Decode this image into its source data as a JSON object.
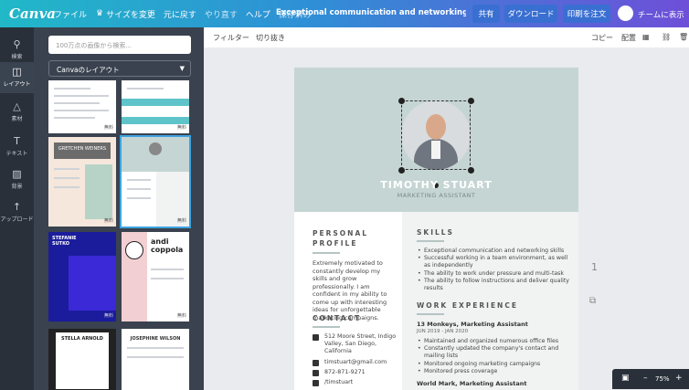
{
  "topbar": {
    "logo": "Canva",
    "menu": [
      "ファイル",
      "サイズを変更",
      "元に戻す",
      "やり直す",
      "ヘルプ",
      "保存済み"
    ],
    "doc_title": "Exceptional communication and networking skillsSucce...",
    "share": "共有",
    "download": "ダウンロード",
    "print": "印刷を注文",
    "team": "チームに表示"
  },
  "rail": {
    "items": [
      {
        "label": "検索",
        "icon": "search-icon"
      },
      {
        "label": "レイアウト",
        "icon": "layout-icon"
      },
      {
        "label": "素材",
        "icon": "elements-icon"
      },
      {
        "label": "テキスト",
        "icon": "text-icon"
      },
      {
        "label": "背景",
        "icon": "background-icon"
      },
      {
        "label": "アップロード",
        "icon": "upload-icon"
      }
    ]
  },
  "panel": {
    "search_placeholder": "100万点の画像から検索...",
    "select_value": "Canvaのレイアウト",
    "free_label": "無料",
    "thumbs": [
      {
        "name": "",
        "color": "#ffffff",
        "accent": "#e5e7ea"
      },
      {
        "name": "",
        "color": "#ffffff",
        "accent": "#5fc4c9"
      },
      {
        "name": "GRETCHEN WEINERS",
        "color": "#f5e7dc",
        "accent": "#6b6b6b"
      },
      {
        "name": "",
        "color": "#ffffff",
        "accent": "#c5d5d3"
      },
      {
        "name": "STEFANIE SUTKO",
        "color": "#1b1c9c",
        "accent": "#3b28d6"
      },
      {
        "name": "andi coppola",
        "color": "#ffffff",
        "accent": "#f2cfd3"
      },
      {
        "name": "STELLA ARNOLD",
        "color": "#ffffff",
        "accent": "#222222"
      },
      {
        "name": "JOSEPHINE WILSON",
        "color": "#ffffff",
        "accent": "#333333"
      }
    ]
  },
  "subbar": {
    "filter": "フィルター",
    "crop": "切り抜き",
    "copy": "コピー",
    "arrange": "配置"
  },
  "resume": {
    "name": "TIMOTHY STUART",
    "role": "MARKETING ASSISTANT",
    "profile_heading": "PERSONAL PROFILE",
    "profile_text": "Extremely motivated to constantly develop my skills and grow professionally. I am confident in my ability to come up with interesting ideas for unforgettable marketing campaigns.",
    "contact_heading": "CONTACT",
    "contacts": [
      {
        "icon": "location-icon",
        "text": "512 Moore Street, Indigo Valley, San Diego, California"
      },
      {
        "icon": "email-icon",
        "text": "timstuart@gmail.com"
      },
      {
        "icon": "phone-icon",
        "text": "872-871-9271"
      },
      {
        "icon": "social-icon",
        "text": "/timstuart"
      }
    ],
    "skills_heading": "SKILLS",
    "skills": [
      "Exceptional communication and networking skills",
      "Successful working in a team environment, as well as independently",
      "The ability to work under pressure and multi-task",
      "The ability to follow instructions and deliver quality results"
    ],
    "work_heading": "WORK EXPERIENCE",
    "job1_title": "13 Monkeys, Marketing Assistant",
    "job1_dates": "JUN 2019 - JAN 2020",
    "job1_points": [
      "Maintained and organized numerous office files",
      "Constantly updated the company's contact and mailing lists",
      "Monitored ongoing marketing campaigns",
      "Monitored press coverage"
    ],
    "job2_title": "World Mark, Marketing Assistant"
  },
  "side": {
    "page_number": "1"
  },
  "bottombar": {
    "zoom": "75%",
    "minus": "–",
    "plus": "+"
  }
}
